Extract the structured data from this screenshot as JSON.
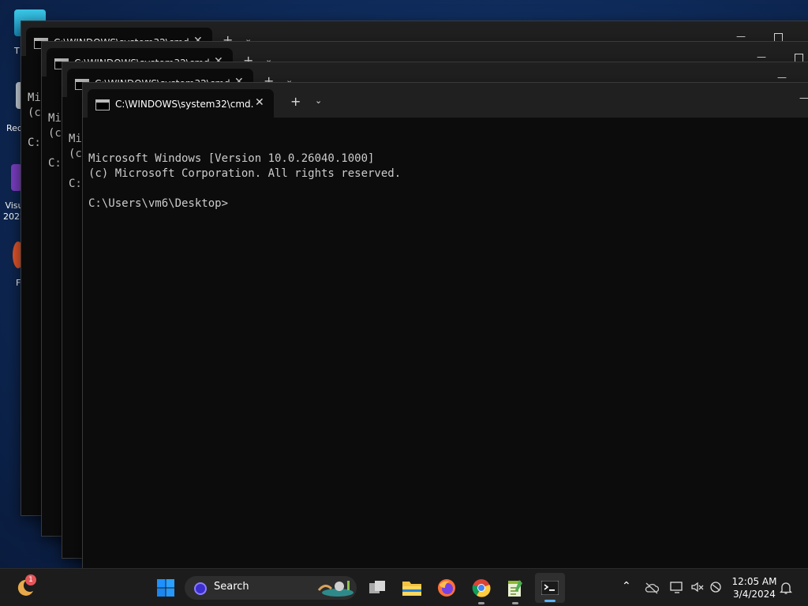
{
  "desktop": {
    "icons": [
      {
        "label": "T"
      },
      {
        "label": "Rec"
      },
      {
        "label": "Visu\n2022"
      },
      {
        "label": "F"
      }
    ]
  },
  "windows": [
    {
      "tab_title": "C:\\WINDOWS\\system32\\cmd.",
      "lines": [
        "Mi",
        "(c",
        "",
        "C:"
      ]
    },
    {
      "tab_title": "C:\\WINDOWS\\system32\\cmd.",
      "lines": [
        "Mi",
        "(c",
        "",
        "C:"
      ]
    },
    {
      "tab_title": "C:\\WINDOWS\\system32\\cmd.",
      "lines": [
        "Mi",
        "(c",
        "",
        "C:"
      ]
    },
    {
      "tab_title": "C:\\WINDOWS\\system32\\cmd.",
      "lines": [
        "Microsoft Windows [Version 10.0.26040.1000]",
        "(c) Microsoft Corporation. All rights reserved.",
        "",
        "C:\\Users\\vm6\\Desktop>"
      ]
    }
  ],
  "titlebar": {
    "close": "✕",
    "new_tab": "+",
    "dropdown": "⌄",
    "minimize": "—"
  },
  "taskbar": {
    "widget_badge": "1",
    "search_placeholder": "Search",
    "apps": [
      "windows-start",
      "task-view",
      "file-explorer",
      "firefox",
      "chrome",
      "notepad-plus-plus",
      "terminal"
    ],
    "tray_chevron": "⌃",
    "clock_time": "12:05 AM",
    "clock_date": "3/4/2024"
  },
  "colors": {
    "console_bg": "#0c0c0c",
    "titlebar_bg": "#202020",
    "taskbar_bg": "#1c1c1c",
    "console_text": "#cccccc"
  }
}
